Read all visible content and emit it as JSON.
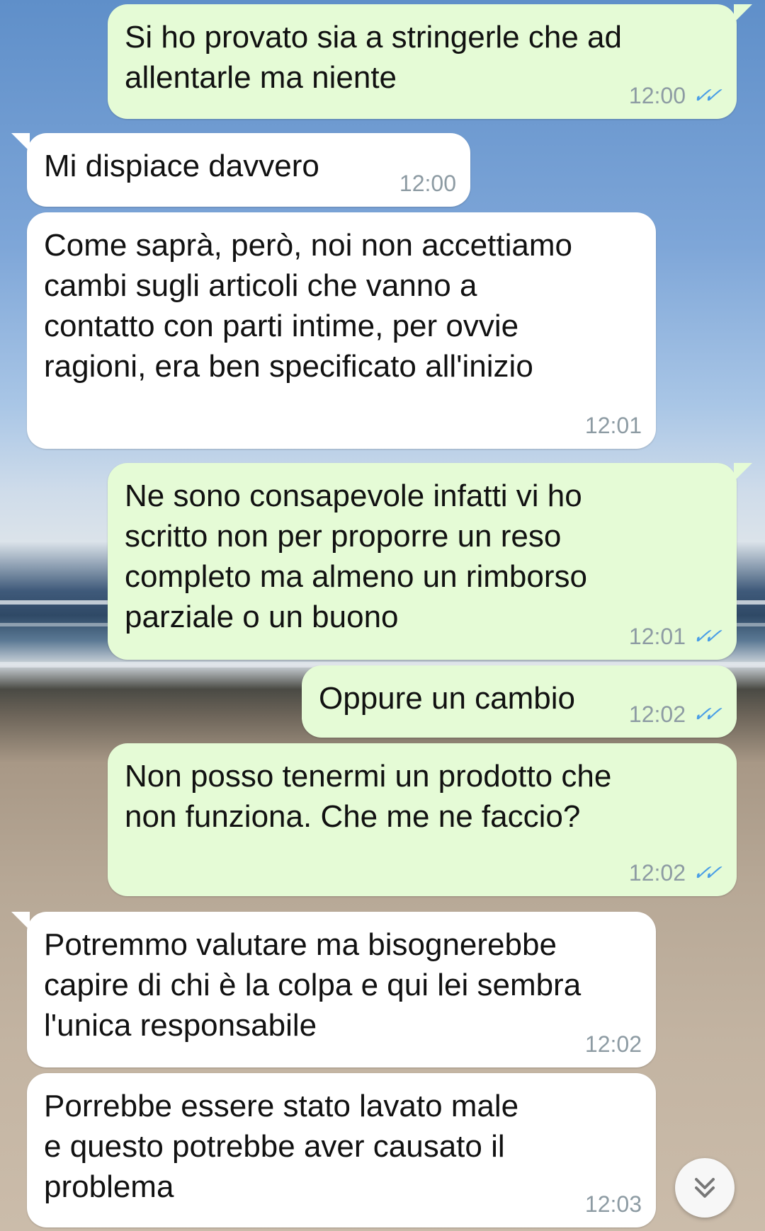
{
  "messages": [
    {
      "id": "m1",
      "dir": "out",
      "text": "Si ho provato sia a stringerle che ad\nallentarle ma niente",
      "time": "12:00",
      "read": "✓✓"
    },
    {
      "id": "m2",
      "dir": "in",
      "text": "Mi dispiace davvero",
      "time": "12:00"
    },
    {
      "id": "m3",
      "dir": "in",
      "text": "Come saprà, però, noi non accettiamo\ncambi sugli articoli che vanno a\ncontatto con parti intime, per ovvie\nragioni, era ben specificato all'inizio",
      "time": "12:01"
    },
    {
      "id": "m4",
      "dir": "out",
      "text": "Ne sono consapevole infatti vi ho\nscritto non per proporre un reso\ncompleto ma almeno un rimborso\nparziale o un buono",
      "time": "12:01",
      "read": "✓✓"
    },
    {
      "id": "m5",
      "dir": "out",
      "text": "Oppure un cambio",
      "time": "12:02",
      "read": "✓✓"
    },
    {
      "id": "m6",
      "dir": "out",
      "text": "Non posso tenermi un prodotto che\nnon funziona. Che me ne faccio?",
      "time": "12:02",
      "read": "✓✓"
    },
    {
      "id": "m7",
      "dir": "in",
      "text": "Potremmo valutare ma bisognerebbe\ncapire di chi è la colpa e qui lei sembra\nl'unica responsabile",
      "time": "12:02"
    },
    {
      "id": "m8",
      "dir": "in",
      "text": "Porrebbe essere stato lavato male\ne questo potrebbe aver causato il\nproblema",
      "time": "12:03"
    }
  ],
  "scroll_button": {
    "icon": "chevron-double-down-icon"
  },
  "colors": {
    "incoming": "#ffffff",
    "outgoing": "#e5fbd6",
    "read_ticks": "#4a9ee6",
    "time": "#8d9ba3"
  }
}
